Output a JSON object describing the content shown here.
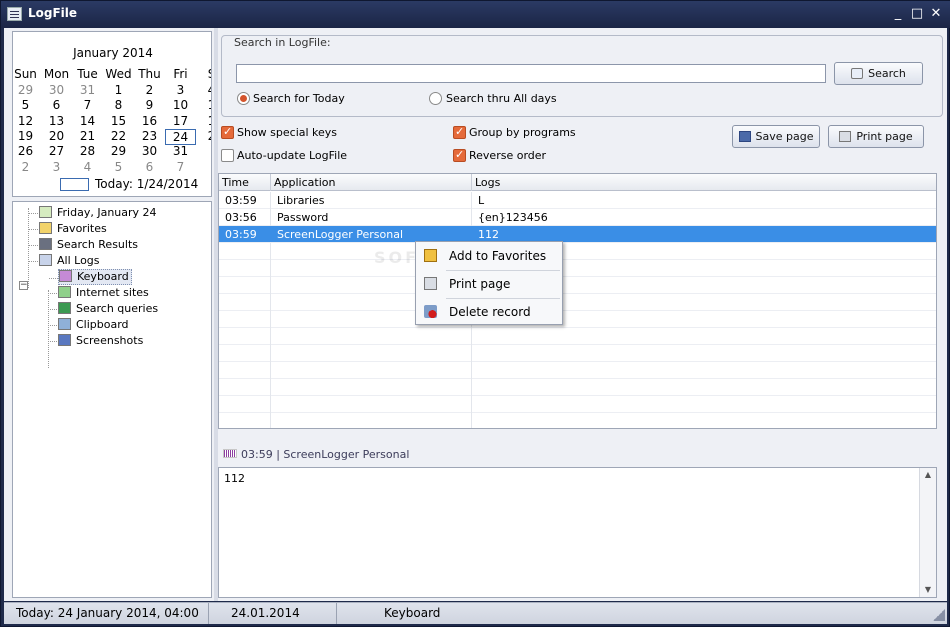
{
  "window": {
    "title": "LogFile",
    "controls": [
      "_",
      "□",
      "✕"
    ]
  },
  "calendar": {
    "month_title": "January 2014",
    "weekdays": [
      "Sun",
      "Mon",
      "Tue",
      "Wed",
      "Thu",
      "Fri",
      "S"
    ],
    "rows": [
      [
        "29",
        "30",
        "31",
        "1",
        "2",
        "3",
        "4"
      ],
      [
        "5",
        "6",
        "7",
        "8",
        "9",
        "10",
        "1"
      ],
      [
        "12",
        "13",
        "14",
        "15",
        "16",
        "17",
        "1"
      ],
      [
        "19",
        "20",
        "21",
        "22",
        "23",
        "24",
        "2"
      ],
      [
        "26",
        "27",
        "28",
        "29",
        "30",
        "31",
        ""
      ],
      [
        "2",
        "3",
        "4",
        "5",
        "6",
        "7",
        ""
      ]
    ],
    "selected_day": "24",
    "today_label": "Today: 1/24/2014"
  },
  "tree": {
    "items": [
      {
        "label": "Friday, January 24",
        "icon": "calendar-icon"
      },
      {
        "label": "Favorites",
        "icon": "favorites-icon"
      },
      {
        "label": "Search Results",
        "icon": "binoculars-icon"
      },
      {
        "label": "All Logs",
        "icon": "log-icon",
        "expander": "−"
      },
      {
        "label": "Keyboard",
        "icon": "keyboard-icon"
      },
      {
        "label": "Internet sites",
        "icon": "internet-icon"
      },
      {
        "label": "Search queries",
        "icon": "search-query-icon"
      },
      {
        "label": "Clipboard",
        "icon": "clipboard-icon"
      },
      {
        "label": "Screenshots",
        "icon": "screenshot-icon"
      }
    ]
  },
  "search": {
    "group_label": "Search in LogFile:",
    "input_value": "",
    "button_label": "Search",
    "radio_today": "Search for Today",
    "radio_all": "Search thru All days"
  },
  "options": {
    "show_special_keys": "Show special keys",
    "auto_update": "Auto-update LogFile",
    "group_by_programs": "Group by programs",
    "reverse_order": "Reverse order"
  },
  "buttons": {
    "save_page": "Save page",
    "print_page": "Print page"
  },
  "grid": {
    "columns": [
      "Time",
      "Application",
      "Logs"
    ],
    "rows": [
      [
        "03:59",
        "Libraries",
        "L"
      ],
      [
        "03:56",
        "Password",
        "{en}123456"
      ],
      [
        "03:59",
        "ScreenLogger Personal",
        "112"
      ]
    ],
    "selected_index": 2
  },
  "context_menu": {
    "items": [
      "Add to Favorites",
      "Print page",
      "Delete record"
    ]
  },
  "watermark": "SOFTPEDIA",
  "detail": {
    "header": "03:59 | ScreenLogger Personal",
    "content": "112"
  },
  "status": {
    "today": "Today: 24 January 2014, 04:00",
    "date": "24.01.2014",
    "section": "Keyboard"
  },
  "colors": {
    "accent_check": "#e56a3a",
    "selection": "#3a8ee6",
    "frame": "#1f2a4a"
  }
}
